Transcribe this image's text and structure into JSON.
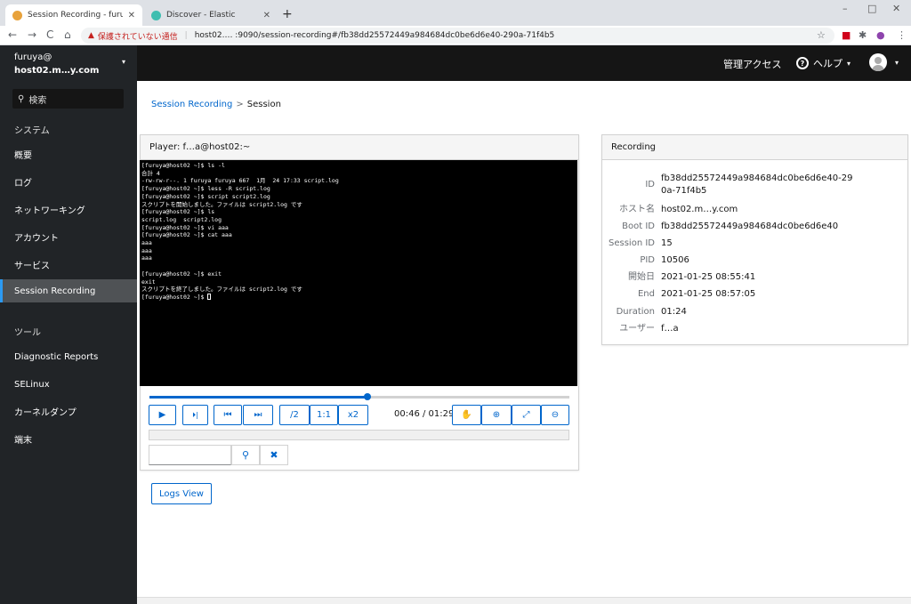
{
  "browser": {
    "tabs": [
      {
        "title": "Session Recording - furuya@hos",
        "active": true,
        "favicon_color": "#e8a23b"
      },
      {
        "title": "Discover - Elastic",
        "active": false,
        "favicon_color": "#3ebeb0"
      }
    ],
    "new_tab": "+",
    "window_controls": [
      "–",
      "□",
      "✕"
    ],
    "nav": {
      "back": "←",
      "forward": "→",
      "reload": "C",
      "home": "⌂"
    },
    "security_icon": "▲",
    "security_text": "保護されていない通信",
    "url": "host02.… :9090/session-recording#/fb38dd25572449a984684dc0be6d6e40-290a-71f4b5",
    "extension_icons": [
      "☆",
      "■",
      "✱",
      "●",
      "⋮"
    ]
  },
  "sidebar": {
    "user": "furuya@",
    "host": "host02.m…y.com",
    "caret": "▾",
    "search_icon": "⚲",
    "search_placeholder": "検索",
    "sections": [
      {
        "label": "システム",
        "items": [
          "概要",
          "ログ",
          "ネットワーキング",
          "アカウント",
          "サービス",
          "Session Recording"
        ]
      },
      {
        "label": "ツール",
        "items": [
          "Diagnostic Reports",
          "SELinux",
          "カーネルダンプ",
          "端末"
        ]
      }
    ],
    "active_item": "Session Recording"
  },
  "topbar": {
    "admin": "管理アクセス",
    "help_icon": "?",
    "help": "ヘルプ",
    "caret": "▾"
  },
  "breadcrumb": {
    "parent": "Session Recording",
    "separator": ">",
    "current": "Session"
  },
  "player": {
    "title": "Player: f…a@host02:~",
    "terminal_lines": [
      "[furuya@host02 ~]$ ls -l",
      "合計 4",
      "-rw-rw-r--. 1 furuya furuya 667  1月  24 17:33 script.log",
      "[furuya@host02 ~]$ less -R script.log",
      "[furuya@host02 ~]$ script script2.log",
      "スクリプトを開始しました。ファイルは script2.log です",
      "[furuya@host02 ~]$ ls",
      "script.log  script2.log",
      "[furuya@host02 ~]$ vi aaa",
      "[furuya@host02 ~]$ cat aaa",
      "aaa",
      "aaa",
      "aaa",
      "",
      "[furuya@host02 ~]$ exit",
      "exit",
      "スクリプトを終了しました。ファイルは script2.log です",
      "[furuya@host02 ~]$ "
    ],
    "progress_percent": 52,
    "controls": {
      "play_icon": "▶",
      "step_icon": "⏵|",
      "rewind_icon": "⏮",
      "fastforward_icon": "⏭",
      "speed_half": "/2",
      "speed_normal": "1:1",
      "speed_double": "x2",
      "drag_icon": "✋",
      "zoom_in_icon": "⊕",
      "fit_icon": "⤢",
      "zoom_out_icon": "⊖"
    },
    "time": "00:46 / 01:29",
    "search_icon": "⚲",
    "clear_icon": "✖"
  },
  "logs_view": "Logs View",
  "recording": {
    "title": "Recording",
    "fields": [
      {
        "label": "ID",
        "value": "fb38dd25572449a984684dc0be6d6e40-290a-71f4b5"
      },
      {
        "label": "ホスト名",
        "value": "host02.m…y.com"
      },
      {
        "label": "Boot ID",
        "value": "fb38dd25572449a984684dc0be6d6e40"
      },
      {
        "label": "Session ID",
        "value": "15"
      },
      {
        "label": "PID",
        "value": "10506"
      },
      {
        "label": "開始日",
        "value": "2021-01-25 08:55:41"
      },
      {
        "label": "End",
        "value": "2021-01-25 08:57:05"
      },
      {
        "label": "Duration",
        "value": "01:24"
      },
      {
        "label": "ユーザー",
        "value": "f…a"
      }
    ]
  }
}
